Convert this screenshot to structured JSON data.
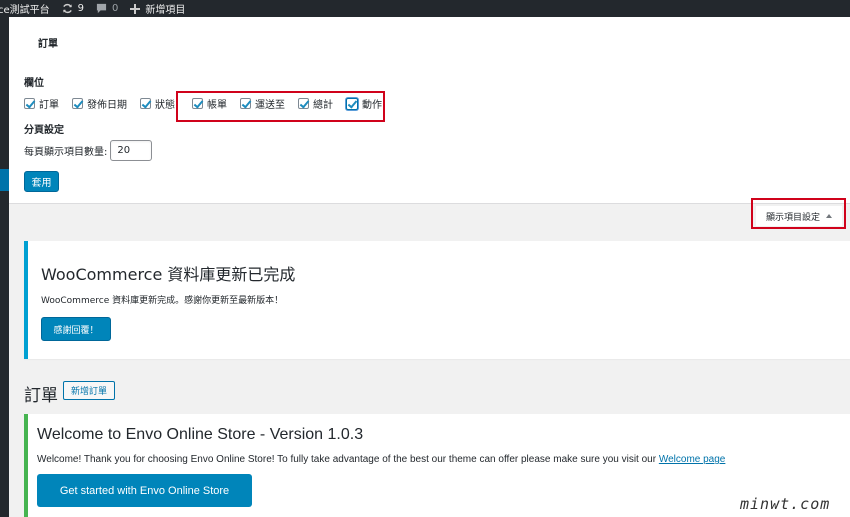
{
  "adminbar": {
    "site_name": "ce測試平台",
    "updates_count": "9",
    "comments_count": "0",
    "new_label": "新增項目"
  },
  "screen_options": {
    "title": "訂單",
    "columns_heading": "欄位",
    "columns": [
      {
        "label": "訂單",
        "checked": true
      },
      {
        "label": "發佈日期",
        "checked": true
      },
      {
        "label": "狀態",
        "checked": true
      },
      {
        "label": "帳單",
        "checked": true
      },
      {
        "label": "運送至",
        "checked": true
      },
      {
        "label": "總計",
        "checked": true
      },
      {
        "label": "動作",
        "checked": true
      }
    ],
    "pagination_heading": "分頁設定",
    "per_page_label": "每頁顯示項目數量:",
    "per_page_value": "20",
    "apply_label": "套用",
    "toggle_label": "顯示項目設定"
  },
  "notice_update": {
    "title": "WooCommerce 資料庫更新已完成",
    "text": "WooCommerce 資料庫更新完成。感謝你更新至最新版本！",
    "button": "感謝回覆！"
  },
  "page": {
    "title": "訂單",
    "add_new": "新增訂單"
  },
  "notice_welcome": {
    "title": "Welcome to Envo Online Store - Version 1.0.3",
    "text": "Welcome! Thank you for choosing Envo Online Store! To fully take advantage of the best our theme can offer please make sure you visit our ",
    "link": "Welcome page",
    "button": "Get started with Envo Online Store"
  },
  "watermark": "minwt.com",
  "colors": {
    "adminbar": "#23282d",
    "primary": "#0085ba",
    "info_border": "#00a0d2",
    "success_border": "#46b450",
    "highlight": "#d0021b"
  }
}
